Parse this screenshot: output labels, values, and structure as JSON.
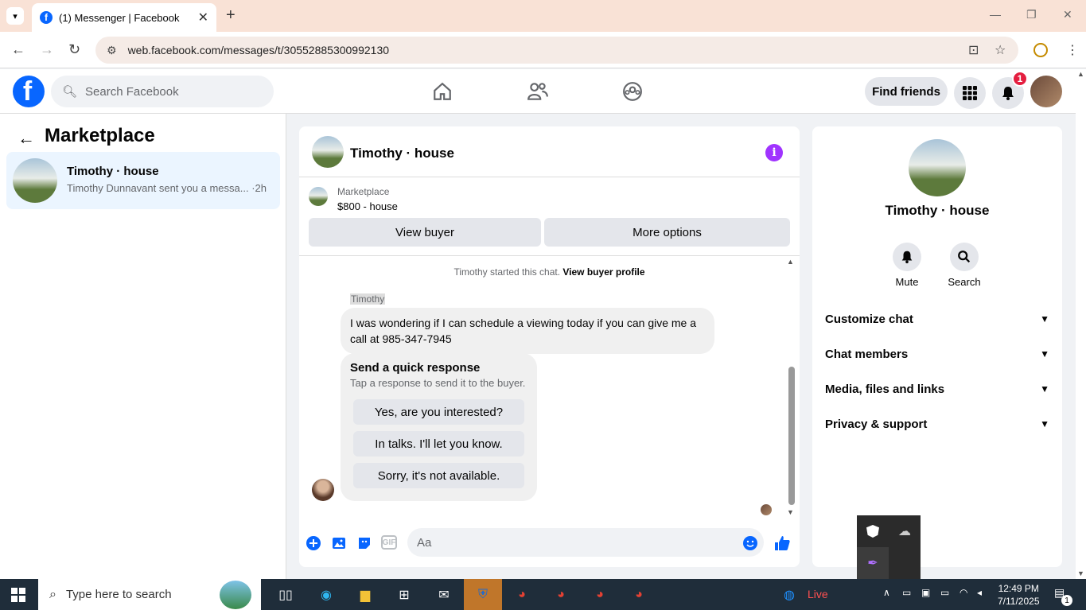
{
  "browser": {
    "tab_title": "(1) Messenger | Facebook",
    "tab_favicon_letter": "f",
    "url": "web.facebook.com/messages/t/30552885300992130"
  },
  "fb_header": {
    "logo_letter": "f",
    "search_placeholder": "Search Facebook",
    "find_friends": "Find friends",
    "notification_count": "1"
  },
  "sidebar": {
    "title": "Marketplace",
    "conversations": [
      {
        "name": "Timothy · house",
        "preview": "Timothy Dunnavant sent you a messa...",
        "time": "·2h"
      }
    ]
  },
  "chat": {
    "title": "Timothy · house",
    "marketplace_label": "Marketplace",
    "listing": "$800 - house",
    "view_buyer": "View buyer",
    "more_options": "More options",
    "started_text": "Timothy started this chat.",
    "view_buyer_profile": "View buyer profile",
    "sender_name": "Timothy",
    "message": "I was wondering if I can schedule a viewing today if you can give me a call at 985-347-7945",
    "quick_response": {
      "title": "Send a quick response",
      "subtitle": "Tap a response to send it to the buyer.",
      "options": [
        "Yes, are you interested?",
        "In talks. I'll let you know.",
        "Sorry, it's not available."
      ]
    },
    "composer_placeholder": "Aa"
  },
  "details": {
    "name": "Timothy · house",
    "mute": "Mute",
    "search": "Search",
    "sections": [
      "Customize chat",
      "Chat members",
      "Media, files and links",
      "Privacy & support"
    ]
  },
  "taskbar": {
    "search_placeholder": "Type here to search",
    "live": "Live",
    "time": "12:49 PM",
    "date": "7/11/2025",
    "notif_count": "1"
  },
  "colors": {
    "brand": "#0866ff",
    "accent": "#a033ff",
    "badge": "#e41e3f"
  }
}
